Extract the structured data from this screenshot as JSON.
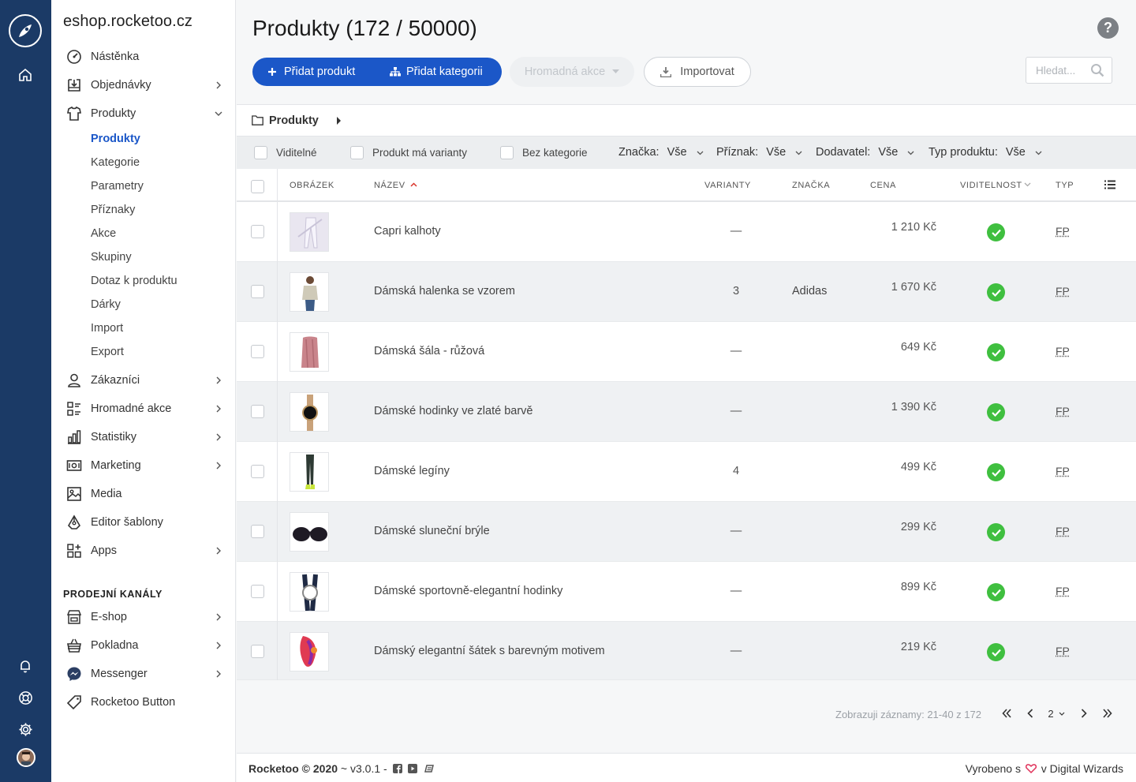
{
  "app": {
    "shop_name": "eshop.rocketoo.cz"
  },
  "sidebar": {
    "items": [
      {
        "label": "Nástěnka"
      },
      {
        "label": "Objednávky"
      },
      {
        "label": "Produkty"
      },
      {
        "label": "Zákazníci"
      },
      {
        "label": "Hromadné akce"
      },
      {
        "label": "Statistiky"
      },
      {
        "label": "Marketing"
      },
      {
        "label": "Media"
      },
      {
        "label": "Editor šablony"
      },
      {
        "label": "Apps"
      }
    ],
    "submenu": [
      {
        "label": "Produkty"
      },
      {
        "label": "Kategorie"
      },
      {
        "label": "Parametry"
      },
      {
        "label": "Příznaky"
      },
      {
        "label": "Akce"
      },
      {
        "label": "Skupiny"
      },
      {
        "label": "Dotaz k produktu"
      },
      {
        "label": "Dárky"
      },
      {
        "label": "Import"
      },
      {
        "label": "Export"
      }
    ],
    "channels_title": "PRODEJNÍ KANÁLY",
    "channels": [
      {
        "label": "E-shop"
      },
      {
        "label": "Pokladna"
      },
      {
        "label": "Messenger"
      },
      {
        "label": "Rocketoo Button"
      }
    ]
  },
  "header": {
    "title": "Produkty (172 / 50000)",
    "add_product": "Přidat produkt",
    "add_category": "Přidat kategorii",
    "mass_action": "Hromadná akce",
    "import": "Importovat",
    "search_placeholder": "Hledat..."
  },
  "breadcrumb": {
    "label": "Produkty"
  },
  "filters": {
    "visible": "Viditelné",
    "has_variants": "Produkt má varianty",
    "no_category": "Bez kategorie",
    "brand_label": "Značka:",
    "brand_value": "Vše",
    "flag_label": "Příznak:",
    "flag_value": "Vše",
    "supplier_label": "Dodavatel:",
    "supplier_value": "Vše",
    "type_label": "Typ produktu:",
    "type_value": "Vše"
  },
  "table": {
    "headers": {
      "image": "OBRÁZEK",
      "name": "NÁZEV",
      "variants": "VARIANTY",
      "brand": "ZNAČKA",
      "price": "CENA",
      "visibility": "VIDITELNOST",
      "type": "TYP"
    },
    "rows": [
      {
        "name": "Capri kalhoty",
        "variants": "—",
        "brand": "",
        "price": "1 210 Kč",
        "type": "FP"
      },
      {
        "name": "Dámská halenka se vzorem",
        "variants": "3",
        "brand": "Adidas",
        "price": "1 670 Kč",
        "type": "FP"
      },
      {
        "name": "Dámská šála - růžová",
        "variants": "—",
        "brand": "",
        "price": "649 Kč",
        "type": "FP"
      },
      {
        "name": "Dámské hodinky ve zlaté barvě",
        "variants": "—",
        "brand": "",
        "price": "1 390 Kč",
        "type": "FP"
      },
      {
        "name": "Dámské legíny",
        "variants": "4",
        "brand": "",
        "price": "499 Kč",
        "type": "FP"
      },
      {
        "name": "Dámské sluneční brýle",
        "variants": "—",
        "brand": "",
        "price": "299 Kč",
        "type": "FP"
      },
      {
        "name": "Dámské sportovně-elegantní hodinky",
        "variants": "—",
        "brand": "",
        "price": "899 Kč",
        "type": "FP"
      },
      {
        "name": "Dámský elegantní šátek s barevným motivem",
        "variants": "—",
        "brand": "",
        "price": "219 Kč",
        "type": "FP"
      }
    ]
  },
  "pagination": {
    "summary": "Zobrazuji záznamy: 21-40 z 172",
    "current_page": "2"
  },
  "footer": {
    "left": "Rocketoo © 2020",
    "version": "~ v3.0.1 -",
    "right_prefix": "Vyrobeno s",
    "right_suffix": "v Digital Wizards"
  },
  "colors": {
    "rail": "#1b3a66",
    "primary": "#1b57c8",
    "visible_ok": "#3fbf3f"
  }
}
